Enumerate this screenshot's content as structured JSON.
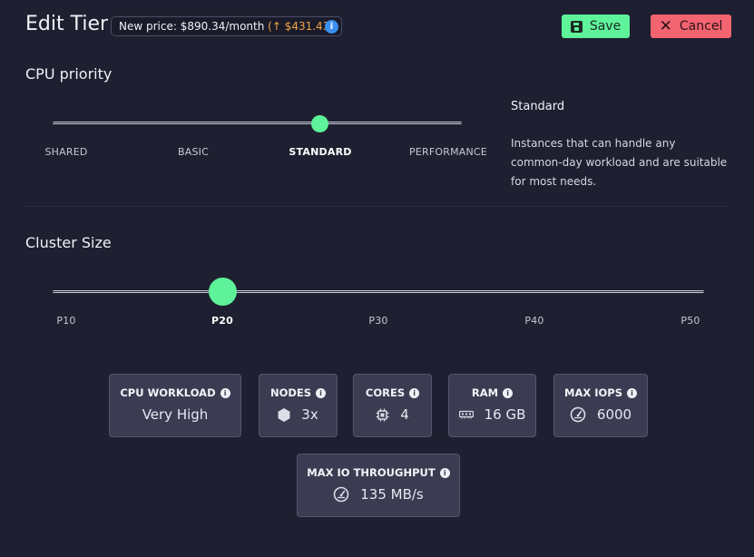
{
  "header": {
    "title": "Edit Tier",
    "price_label": "New price: $890.34/month",
    "price_delta": "(↑ $431.43)",
    "info_glyph": "i",
    "save_label": "Save",
    "cancel_label": "Cancel",
    "cancel_glyph": "✕"
  },
  "cpu_priority": {
    "title": "CPU priority",
    "options": [
      "SHARED",
      "BASIC",
      "STANDARD",
      "PERFORMANCE"
    ],
    "selected_index": 2,
    "description_title": "Standard",
    "description": "Instances that can handle any common-day workload and are suitable for most needs."
  },
  "cluster_size": {
    "title": "Cluster Size",
    "options": [
      "P10",
      "P20",
      "P30",
      "P40",
      "P50"
    ],
    "selected_index": 1
  },
  "stats": {
    "cpu_workload": {
      "label": "CPU WORKLOAD",
      "value": "Very High"
    },
    "nodes": {
      "label": "NODES",
      "value": "3x",
      "icon": "hexagon-icon"
    },
    "cores": {
      "label": "CORES",
      "value": "4",
      "icon": "cpu-chip-icon"
    },
    "ram": {
      "label": "RAM",
      "value": "16 GB",
      "icon": "memory-icon"
    },
    "max_iops": {
      "label": "MAX IOPS",
      "value": "6000",
      "icon": "gauge-icon"
    },
    "max_io_throughput": {
      "label": "MAX IO THROUGHPUT",
      "value": "135 MB/s",
      "icon": "gauge-icon"
    },
    "info_glyph": "i"
  },
  "colors": {
    "background": "#1e1f30",
    "accent_green": "#5ef29a",
    "danger_red": "#f26470",
    "price_up": "#f2a447",
    "info_blue": "#3b8ff0",
    "card_bg": "#3b3c52"
  }
}
